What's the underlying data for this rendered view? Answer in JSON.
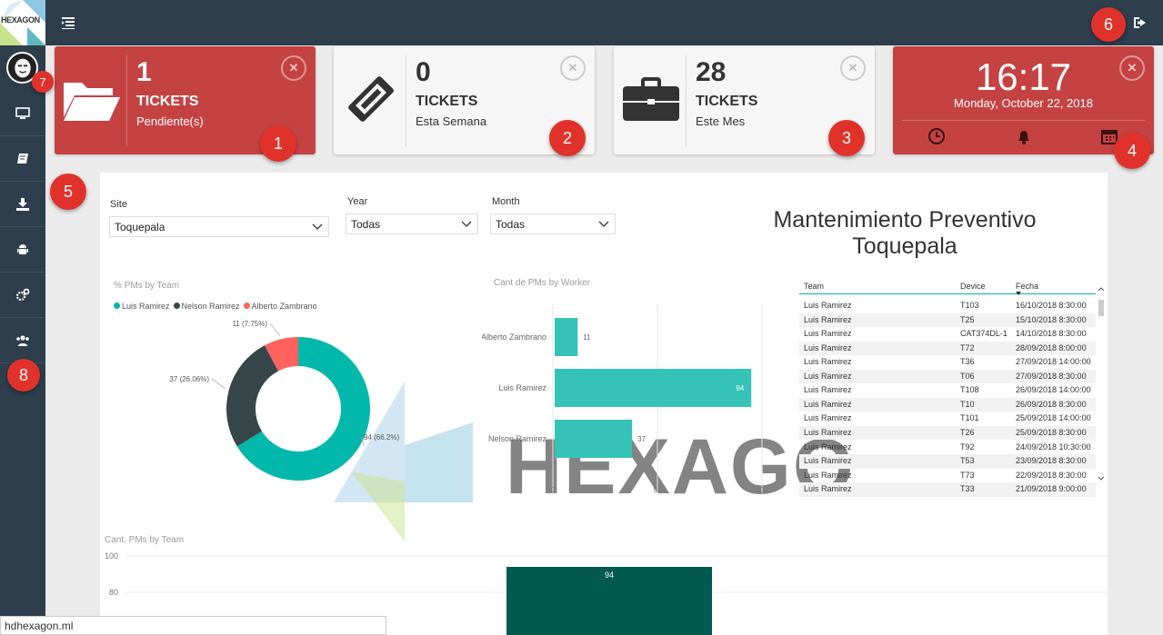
{
  "app": {
    "logo_text": "HEXAGON"
  },
  "colors": {
    "dark": "#2e3e4c",
    "red": "#c54243",
    "teal": "#01b8aa",
    "charcoal": "#374649",
    "coral": "#fd625e",
    "darkgreen": "#005a50",
    "badge": "#e0322b"
  },
  "header": {
    "menu_icon": "menu-toggle-icon",
    "logout_icon": "logout-icon"
  },
  "sidebar": {
    "items": [
      "monitor-icon",
      "book-icon",
      "download-icon",
      "android-icon",
      "cogs-icon",
      "users-icon"
    ]
  },
  "annotations": [
    "1",
    "2",
    "3",
    "4",
    "5",
    "6",
    "7",
    "8"
  ],
  "cards": [
    {
      "number": "1",
      "label": "TICKETS",
      "sub": "Pendiente(s)",
      "icon": "folder-open-icon"
    },
    {
      "number": "0",
      "label": "TICKETS",
      "sub": "Esta Semana",
      "icon": "ticket-icon"
    },
    {
      "number": "28",
      "label": "TICKETS",
      "sub": "Este Mes",
      "icon": "briefcase-icon"
    }
  ],
  "clock": {
    "time": "16:17",
    "date": "Monday, October 22, 2018",
    "icons": [
      "clock-icon",
      "bell-icon",
      "calendar-icon"
    ]
  },
  "close_symbol": "✕",
  "filters": {
    "site": {
      "label": "Site",
      "value": "Toquepala"
    },
    "year": {
      "label": "Year",
      "value": "Todas"
    },
    "month": {
      "label": "Month",
      "value": "Todas"
    }
  },
  "report_title_line1": "Mantenimiento Preventivo",
  "report_title_line2": "Toquepala",
  "watermark": {
    "text": "HEXAGO"
  },
  "footer": {
    "url": "hdhexagon.ml"
  },
  "chart_data": [
    {
      "type": "pie",
      "title": "% PMs by Team",
      "legend_position": "top-left",
      "categories": [
        "Luis Ramirez",
        "Nelson Ramirez",
        "Alberto Zambrano"
      ],
      "values": [
        94,
        37,
        11
      ],
      "labels": [
        "94 (66.2%)",
        "37 (26.06%)",
        "11 (7.75%)"
      ]
    },
    {
      "type": "bar",
      "orientation": "horizontal",
      "title": "Cant de PMs by Worker",
      "categories": [
        "Alberto Zambrano",
        "Luis Ramirez",
        "Nelson Ramirez"
      ],
      "values": [
        11,
        94,
        37
      ],
      "xlim": [
        0,
        100
      ],
      "xticks": [
        "0",
        "50",
        "100"
      ]
    },
    {
      "type": "table",
      "columns": [
        "Team",
        "Device",
        "Fecha"
      ],
      "rows": [
        [
          "Luis Ramirez",
          "T103",
          "16/10/2018 8:30:00"
        ],
        [
          "Luis Ramirez",
          "T25",
          "15/10/2018 8:30:00"
        ],
        [
          "Luis Ramirez",
          "CAT374DL-1",
          "14/10/2018 8:30:00"
        ],
        [
          "Luis Ramirez",
          "T72",
          "28/09/2018 8:00:00"
        ],
        [
          "Luis Ramirez",
          "T36",
          "27/09/2018 14:00:00"
        ],
        [
          "Luis Ramirez",
          "T06",
          "27/09/2018 8:30:00"
        ],
        [
          "Luis Ramirez",
          "T108",
          "26/09/2018 14:00:00"
        ],
        [
          "Luis Ramirez",
          "T10",
          "26/09/2018 8:30:00"
        ],
        [
          "Luis Ramirez",
          "T101",
          "25/09/2018 14:00:00"
        ],
        [
          "Luis Ramirez",
          "T26",
          "25/09/2018 8:30:00"
        ],
        [
          "Luis Ramirez",
          "T92",
          "24/09/2018 10:30:00"
        ],
        [
          "Luis Ramirez",
          "T53",
          "23/09/2018 8:30:00"
        ],
        [
          "Luis Ramirez",
          "T73",
          "22/09/2018 8:30:00"
        ],
        [
          "Luis Ramirez",
          "T33",
          "21/09/2018 9:00:00"
        ]
      ]
    },
    {
      "type": "bar",
      "title": "Cant. PMs by Team",
      "yticks": [
        "100",
        "80"
      ],
      "ylim": [
        0,
        100
      ],
      "values": [
        94
      ]
    }
  ]
}
